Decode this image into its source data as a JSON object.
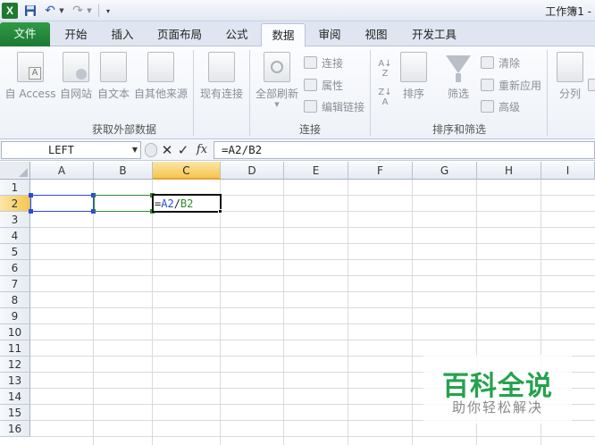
{
  "titlebar": {
    "app_icon_letter": "X",
    "document_title": "工作簿1 -",
    "quick_access": [
      "excel-app-icon",
      "save-icon",
      "undo-icon",
      "redo-icon",
      "customize-dropdown-icon"
    ]
  },
  "tabs": [
    {
      "label": "文件"
    },
    {
      "label": "开始"
    },
    {
      "label": "插入"
    },
    {
      "label": "页面布局"
    },
    {
      "label": "公式"
    },
    {
      "label": "数据",
      "active": true
    },
    {
      "label": "审阅"
    },
    {
      "label": "视图"
    },
    {
      "label": "开发工具"
    }
  ],
  "ribbon": {
    "groups": {
      "external_data": {
        "label": "获取外部数据",
        "buttons": [
          "自 Access",
          "自网站",
          "自文本",
          "自其他来源",
          "现有连接"
        ]
      },
      "connections": {
        "label": "连接",
        "refresh_all": "全部刷新",
        "items": [
          "连接",
          "属性",
          "编辑链接"
        ]
      },
      "sort_filter": {
        "label": "排序和筛选",
        "sort": "排序",
        "filter": "筛选",
        "items": [
          "清除",
          "重新应用",
          "高级"
        ]
      },
      "data_tools": {
        "split": "分列"
      }
    }
  },
  "formula_bar": {
    "name_box": "LEFT",
    "fx": "fx",
    "formula": "=A2/B2"
  },
  "grid": {
    "columns": [
      "A",
      "B",
      "C",
      "D",
      "E",
      "F",
      "G",
      "H",
      "I"
    ],
    "rows": [
      "1",
      "2",
      "3",
      "4",
      "5",
      "6",
      "7",
      "8",
      "9",
      "10",
      "11",
      "12",
      "13",
      "14",
      "15",
      "16"
    ],
    "active_cell": "C2",
    "active_cell_parts": [
      "=",
      "A2",
      "/",
      "B2"
    ],
    "referenced_cells": [
      "A2",
      "B2"
    ],
    "colors": {
      "ref_a2": "#2a4bd7",
      "ref_b2": "#2f8a2f",
      "active_header": "#f6c64d"
    }
  },
  "watermark": {
    "title": "百科全说",
    "subtitle": "助你轻松解决"
  }
}
